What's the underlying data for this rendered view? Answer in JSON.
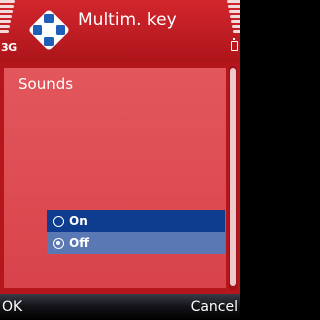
{
  "status": {
    "network_type": "3G",
    "signal_icon": "signal-strength-icon",
    "battery_icon": "battery-icon"
  },
  "title": {
    "text": "Multim. key",
    "icon": "multimedia-key-icon"
  },
  "setting": {
    "label": "Sounds",
    "options": [
      {
        "label": "On",
        "selected": false,
        "highlighted": true
      },
      {
        "label": "Off",
        "selected": true,
        "highlighted": false
      }
    ]
  },
  "softkeys": {
    "left": "OK",
    "right": "Cancel"
  },
  "colors": {
    "title_bg": "#c21b21",
    "panel_bg": "#dd4b51",
    "highlight": "#0e3d8f",
    "option_bg": "#5a78b4",
    "softkey_bg": "#111111"
  }
}
